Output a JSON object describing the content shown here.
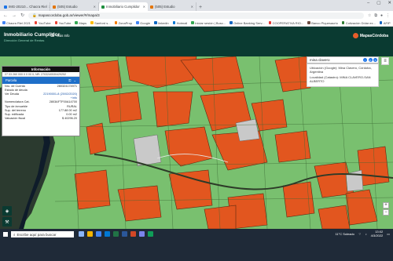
{
  "browser": {
    "tabs": [
      {
        "label": "IMG-20210... Chacra Riel",
        "color": "#1a73e8",
        "active": false
      },
      {
        "label": "(505) Estudio",
        "color": "#e37400",
        "active": false
      },
      {
        "label": "Inmobiliario Cumplidor",
        "color": "#1e8e3e",
        "active": true
      },
      {
        "label": "(505) Estudio",
        "color": "#e37400",
        "active": false
      }
    ],
    "new_tab": "+",
    "url": "mapascordoba.gob.ar/viewer/#/mapa/3",
    "window_controls": [
      "–",
      "▢",
      "✕"
    ],
    "bookmarks": [
      {
        "label": "Chacra Riel 2021",
        "color": "#4285f4"
      },
      {
        "label": "YouTube",
        "color": "#ea4335"
      },
      {
        "label": "YouTube",
        "color": "#ea4335"
      },
      {
        "label": "Maps",
        "color": "#34a853"
      },
      {
        "label": "Sanford s...",
        "color": "#fbbc04"
      },
      {
        "label": "ZonaProp",
        "color": "#f57c00"
      },
      {
        "label": "Google",
        "color": "#4285f4"
      },
      {
        "label": "linkedin",
        "color": "#0a66c2"
      },
      {
        "label": "Hotmail",
        "color": "#0078d4"
      },
      {
        "label": "Iniciar sesión | Busc...",
        "color": "#34a853"
      },
      {
        "label": "Online Banking Serv...",
        "color": "#1565c0"
      },
      {
        "label": "COOPERATIVA RIO...",
        "color": "#e53935"
      },
      {
        "label": "Banco Piquesaurio",
        "color": "#6d4c41"
      },
      {
        "label": "Cotización Dólar ex...",
        "color": "#2e7d32"
      },
      {
        "label": "AFIP",
        "color": "#1565c0"
      },
      {
        "label": "Cotización del Dolar",
        "color": "#43a047"
      },
      {
        "label": "DGR | Territorio",
        "color": "#fb8c00"
      }
    ]
  },
  "app": {
    "title": "Inmobiliario Cumplidor",
    "subtitle": "Dirección General de Rentas",
    "menu_label": "Más Info",
    "logo": "MapasCórdoba"
  },
  "map": {
    "search_value": "mina clavero",
    "location": {
      "line1": "Ubicación (Google): Mina Clavero, Córdoba, Argentina",
      "line2": "Localidad (Catastro): MINA CLAVERO-SAN ALBERTO"
    }
  },
  "info_panel": {
    "title": "Información",
    "nomenclatura": "27 03 260 000 0 0 00 0; NR: 2703240530429252",
    "section": "Parcela",
    "rows": [
      {
        "label": "Nro. de Cuenta",
        "value": "280324174971",
        "style": ""
      },
      {
        "label": "Estado de deuda",
        "value": "",
        "style": "green"
      },
      {
        "label": "Ver Deuda",
        "value": "22190001-8 (20/02/2020)",
        "style": "blue"
      },
      {
        "label": "",
        "value": "+info",
        "style": "blue"
      },
      {
        "label": "Nomenclatura Cat.",
        "value": "2803AFTF00A14700",
        "style": ""
      },
      {
        "label": "Tipo de inmueble",
        "value": "RURAL",
        "style": ""
      },
      {
        "label": "Sup. del terreno",
        "value": "177.88 00 m2",
        "style": ""
      },
      {
        "label": "Sup. edificada",
        "value": "0.00 m2",
        "style": ""
      },
      {
        "label": "Valuación fiscal",
        "value": "$ 40296.20",
        "style": ""
      }
    ]
  },
  "colors": {
    "header": "#0a3a31",
    "parcel_orange": "#e2561f",
    "parcel_green": "#7cc46f",
    "tab_blue": "#1e6fc9"
  },
  "taskbar": {
    "search_placeholder": "Escribe aquí para buscar",
    "weather": "11°C  Soleado",
    "time": "13:02",
    "date": "4/3/2022"
  }
}
